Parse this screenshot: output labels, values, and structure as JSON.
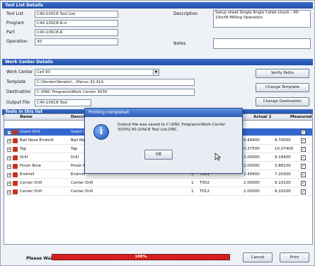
{
  "tool_list_details": {
    "section_title": "Tool List Details",
    "tool_list_label": "Tool List",
    "tool_list_value": "C40-10SC8 Tool List",
    "program_label": "Program",
    "program_value": "C40-10SC8-R.cl",
    "part_label": "Part",
    "part_value": "C40-10SC8-R",
    "operation_label": "Operation",
    "operation_value": "30",
    "description_label": "Description",
    "description_value": "Setup sheet Single Angle Collet chuck - 40-10scf8 Milling Operation",
    "notes_label": "Notes"
  },
  "work_center_details": {
    "section_title": "Work Center Details",
    "work_center_label": "Work Center",
    "work_center_value": "Cell 93",
    "template_label": "Template",
    "template_value": "C:\\Vendor\\Vendor\\...\\Fanuc-32.XLS",
    "destination_label": "Destination",
    "destination_value": "C:\\DNC Programs\\Work Center 3030",
    "output_file_label": "Output File",
    "output_file_value": "C40-10SC8 Tool",
    "verify_button": "Verify Paths",
    "change_template_button": "Change Template",
    "change_destination_button": "Change Destination"
  },
  "tools_section": {
    "section_title": "Tools in this list",
    "columns": [
      "Name",
      "Description",
      "Actual 2",
      "Measured"
    ],
    "rows": [
      {
        "name": "Insert Drill",
        "description": "Insert Drill",
        "qty": "",
        "tool": "",
        "value1": "",
        "value2": "",
        "selected": true
      },
      {
        "name": "Ball Nose Endmill",
        "description": "Ball Nose",
        "qty": "",
        "tool": "",
        "value1": "0.49900",
        "value2": "8.70000",
        "selected": false
      },
      {
        "name": "Tap",
        "description": "Tap",
        "qty": "",
        "tool": "",
        "value1": "0.37500",
        "value2": "10.07400",
        "selected": false
      },
      {
        "name": "Drill",
        "description": "Drill",
        "qty": "1",
        "tool": "T009",
        "value1": "2.00000",
        "value2": "9.19400",
        "selected": false
      },
      {
        "name": "Finish Bore",
        "description": "Finish Bore",
        "qty": "1",
        "tool": "T010",
        "value1": "2.00000",
        "value2": "3.88100",
        "selected": false
      },
      {
        "name": "Endmill",
        "description": "Endmill",
        "qty": "1",
        "tool": "T001",
        "value1": "2.49900",
        "value2": "7.20300",
        "selected": false
      },
      {
        "name": "Center Drill",
        "description": "Center Drill",
        "qty": "1",
        "tool": "T002",
        "value1": "2.00000",
        "value2": "9.10100",
        "selected": false
      },
      {
        "name": "Center Drill",
        "description": "Center Drill",
        "qty": "1",
        "tool": "T012",
        "value1": "2.00000",
        "value2": "9.10200",
        "selected": false
      }
    ]
  },
  "dialog": {
    "title": "Printing completed",
    "message": "Output file was saved to C:\\DNC Programs\\Work Center 3030\\C40-10SC8 Tool List.DNC.",
    "ok_button": "OK"
  },
  "footer": {
    "status_label": "Please Wait...",
    "progress_percent": 100,
    "progress_label": "100%",
    "cancel_button": "Cancel",
    "print_button": "Print"
  },
  "colors": {
    "section_bar": "#1f4fa8",
    "selected_row": "#3368d0",
    "progress_fill": "#e32222"
  }
}
